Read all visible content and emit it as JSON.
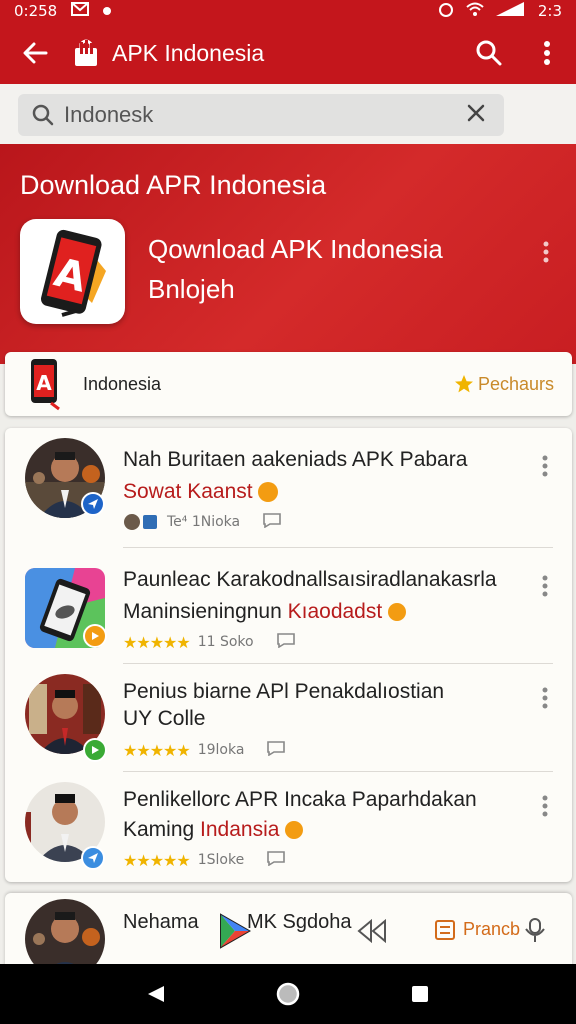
{
  "status_bar": {
    "time": "0:258",
    "right_text": "2:3"
  },
  "app_bar": {
    "title": "APK Indonesia"
  },
  "search": {
    "value": "Indonesk",
    "placeholder": ""
  },
  "hero": {
    "heading": "Download APR Indonesia",
    "app_name": "Qownload APK Indonesia",
    "app_sub": "Bnlojeh"
  },
  "filter": {
    "label": "Indonesia",
    "purchase_label": "Pechaurs"
  },
  "items": [
    {
      "title": "Nah Buritaen aakeniads APK Pabara",
      "subtitle": "Sowat Kaanst",
      "highlight": "",
      "meta": "Te⁴ 1Nioka",
      "badge_color": "#1e64c8"
    },
    {
      "title": "Paunleac Karakodnallsaısiradlanakasrla",
      "subtitle": "Maninsieningnun ",
      "highlight": "Kıaodadst",
      "meta": "11 Soko",
      "badge_color": "#f39c12"
    },
    {
      "title": "Penius biarne APl Penakdalıostian",
      "subtitle": "UY Colle",
      "highlight": "",
      "meta": "19loka",
      "badge_color": "#3aaa35"
    },
    {
      "title": "Penlikellorc APR Incaka  Paparhdakan",
      "subtitle": "Kaming ",
      "highlight": "Indansia",
      "meta": "1Sloke",
      "badge_color": "#3b8de0"
    }
  ],
  "bottom_item": {
    "name": "Nehama",
    "mk": "MK Sgdoha",
    "action": "Prancb"
  },
  "colors": {
    "primary": "#c4161c",
    "accent_star": "#f0b400",
    "action_orange": "#d36b1a"
  }
}
